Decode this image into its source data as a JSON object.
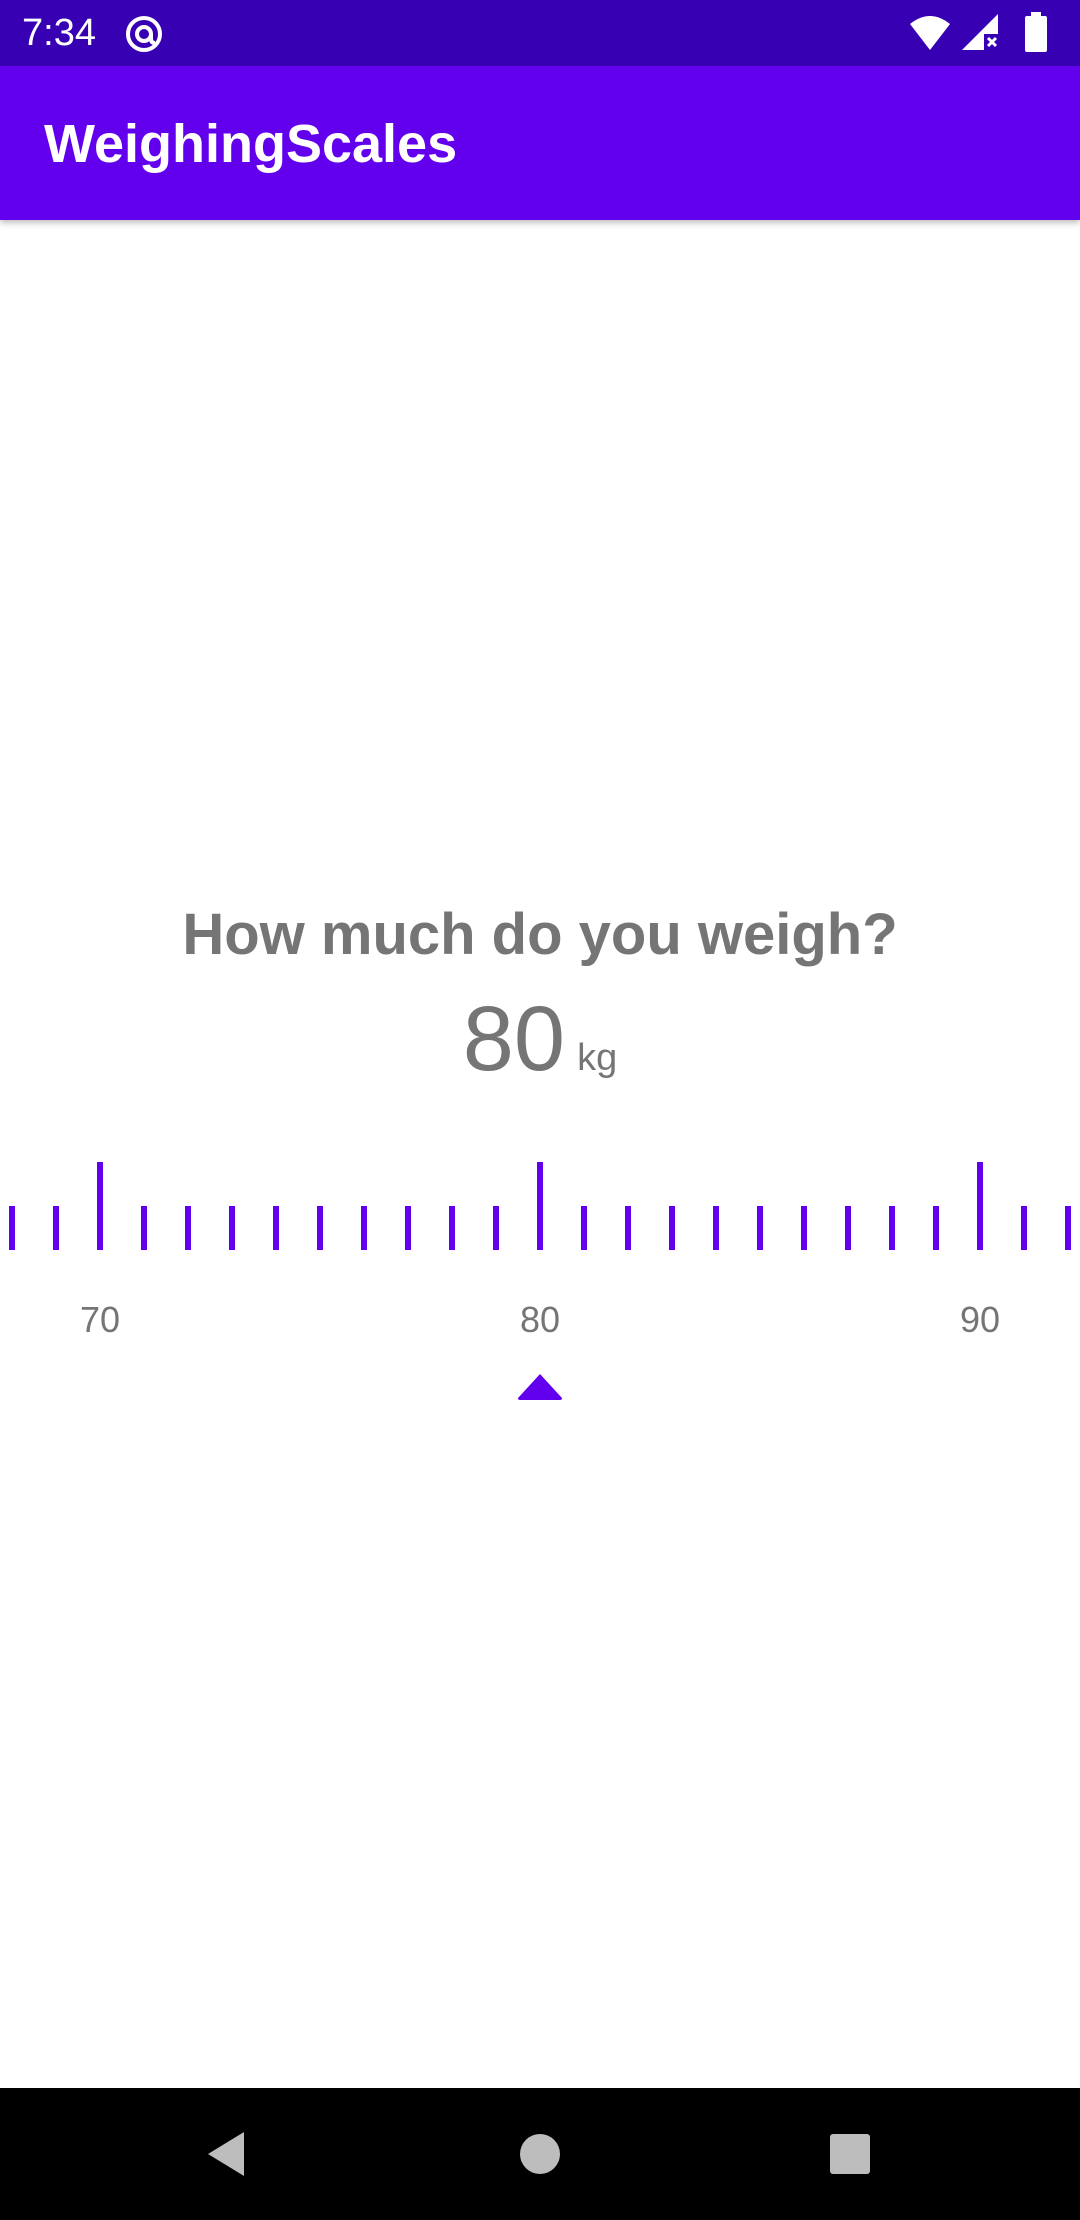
{
  "status_bar": {
    "time": "7:34",
    "icons": [
      "at-sign-icon",
      "wifi-icon",
      "cellular-signal-no-data-icon",
      "battery-icon"
    ],
    "background": "#3700B3"
  },
  "app_bar": {
    "title": "WeighingScales",
    "background": "#6200EE"
  },
  "main": {
    "question": "How much do you weigh?",
    "weight_value": "80",
    "weight_unit": "kg",
    "scale": {
      "selected": 80,
      "min_visible": 68,
      "max_visible": 92,
      "step": 1,
      "major_every": 10,
      "labels": [
        "70",
        "80",
        "90"
      ],
      "accent": "#6200EE",
      "pointer_icon": "triangle-up-icon"
    }
  },
  "nav_bar": {
    "buttons": [
      "back-icon",
      "home-icon",
      "recents-icon"
    ]
  }
}
